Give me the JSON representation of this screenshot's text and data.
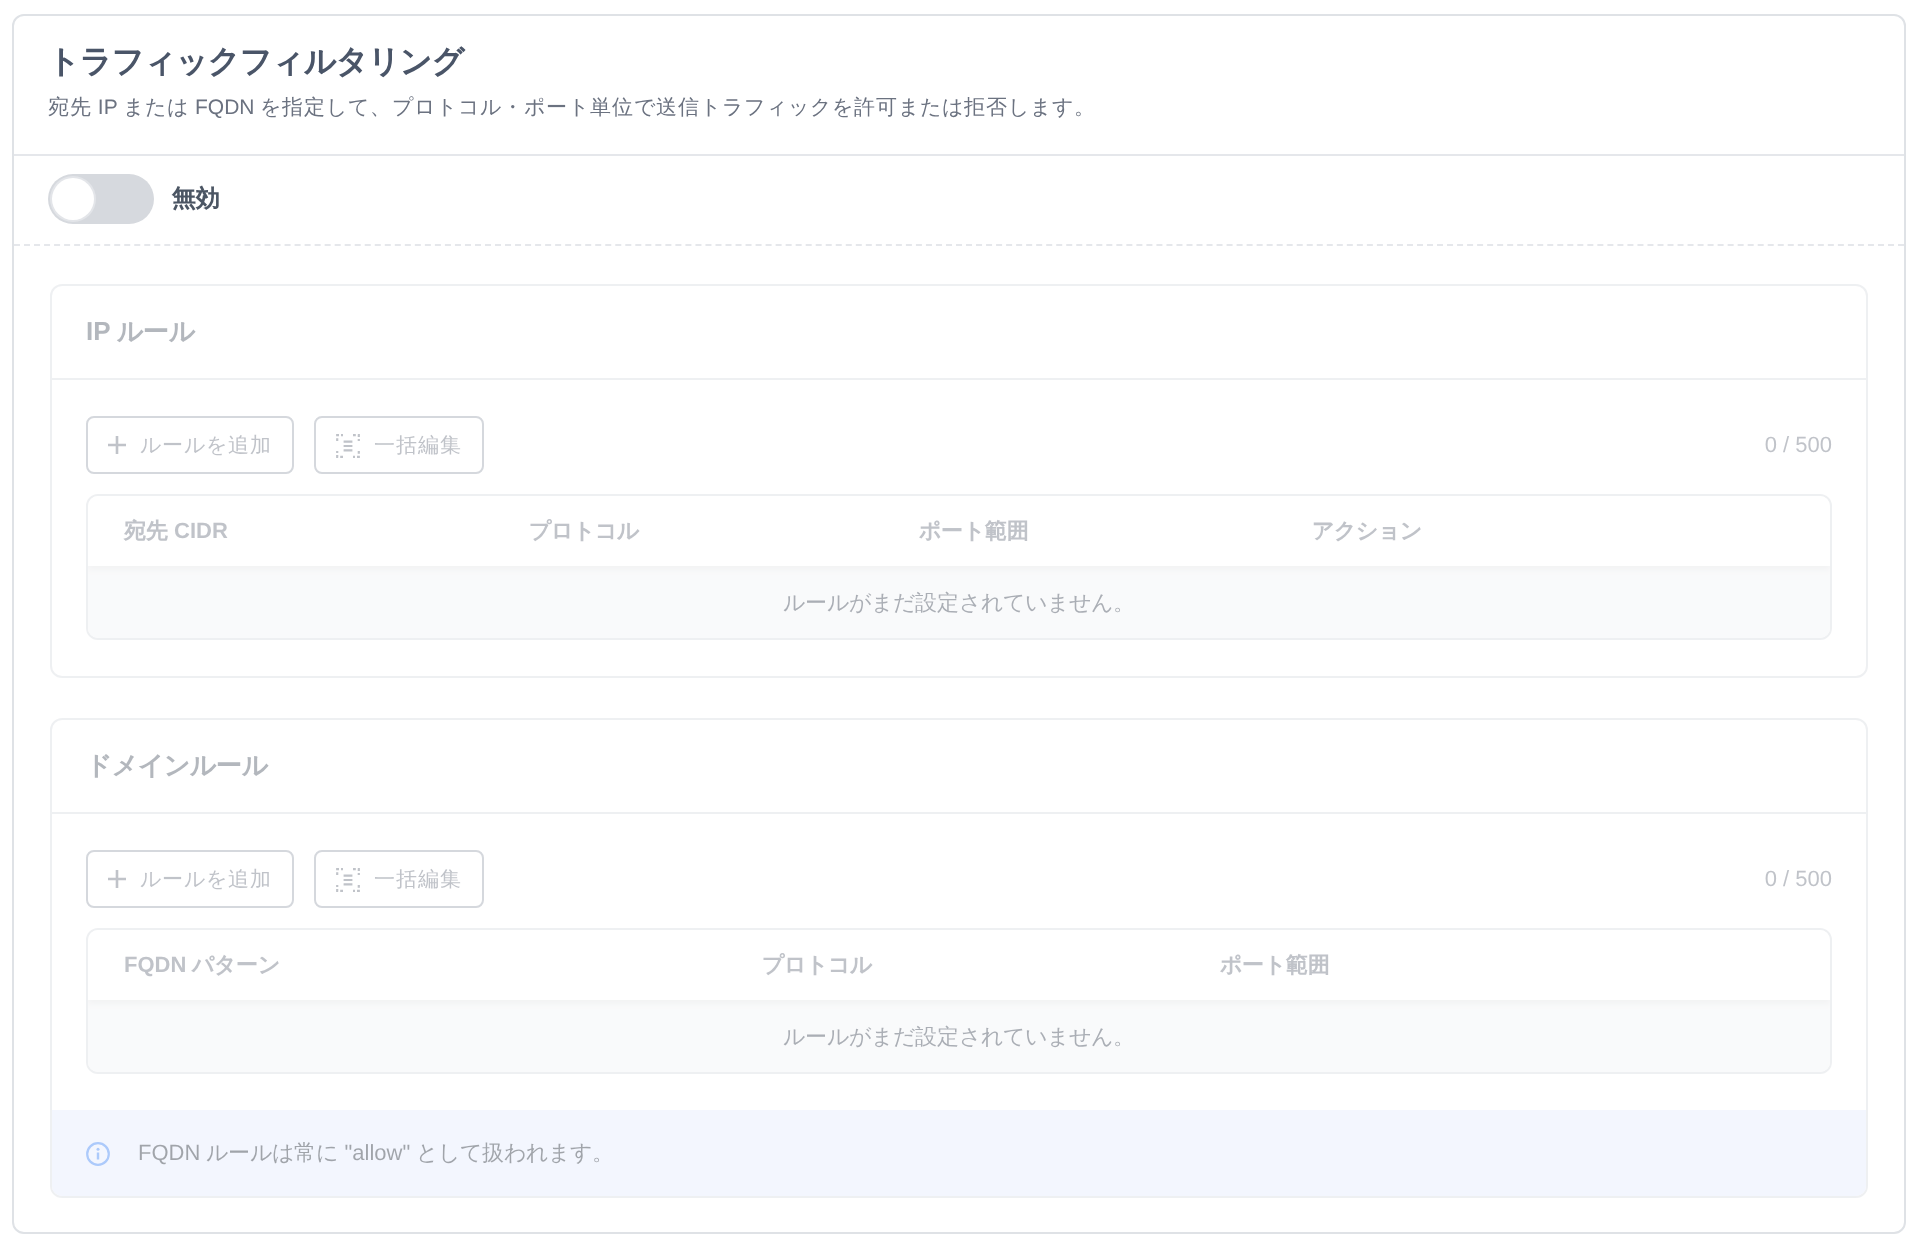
{
  "panel": {
    "title": "トラフィックフィルタリング",
    "description": "宛先 IP または FQDN を指定して、プロトコル・ポート単位で送信トラフィックを許可または拒否します。"
  },
  "toggle": {
    "label": "無効",
    "on": false
  },
  "sections": [
    {
      "title": "IP ルール",
      "buttons": [
        {
          "kind": "add",
          "label": "ルールを追加"
        },
        {
          "kind": "bulk",
          "label": "一括編集"
        }
      ],
      "count": "0 / 500",
      "table": {
        "columns": [
          "宛先 CIDR",
          "プロトコル",
          "ポート範囲",
          "アクション"
        ],
        "empty_message": "ルールがまだ設定されていません。"
      }
    },
    {
      "title": "ドメインルール",
      "buttons": [
        {
          "kind": "add",
          "label": "ルールを追加"
        },
        {
          "kind": "bulk",
          "label": "一括編集"
        }
      ],
      "count": "0 / 500",
      "table": {
        "columns": [
          "FQDN パターン",
          "プロトコル",
          "ポート範囲"
        ],
        "empty_message": "ルールがまだ設定されていません。"
      },
      "note": "FQDN ルールは常に \"allow\" として扱われます。"
    }
  ]
}
